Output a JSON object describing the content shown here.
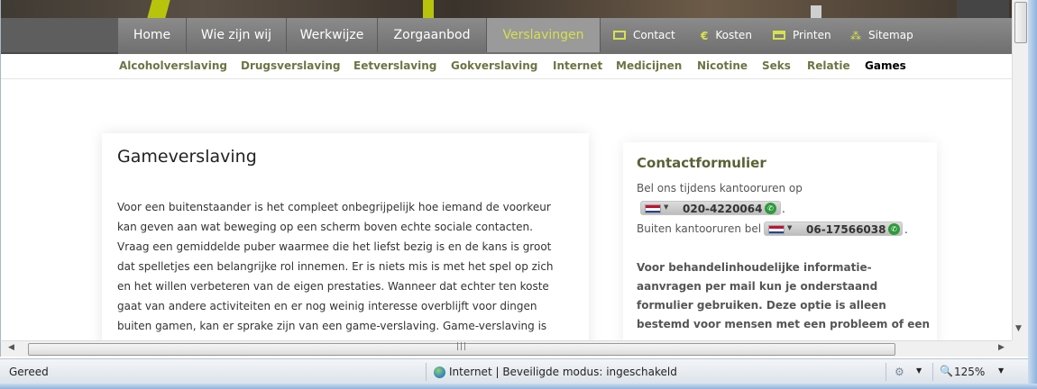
{
  "main_nav": {
    "tabs": [
      {
        "label": "Home"
      },
      {
        "label": "Wie zijn wij"
      },
      {
        "label": "Werkwijze"
      },
      {
        "label": "Zorgaanbod"
      },
      {
        "label": "Verslavingen"
      }
    ],
    "active_tab": "Verslavingen",
    "utility_links": [
      {
        "label": "Contact",
        "icon": "contact-icon"
      },
      {
        "label": "Kosten",
        "icon": "euro-icon"
      },
      {
        "label": "Printen",
        "icon": "print-icon"
      },
      {
        "label": "Sitemap",
        "icon": "sitemap-icon"
      }
    ]
  },
  "sub_nav": {
    "items": [
      "Alcoholverslaving",
      "Drugsverslaving",
      "Eetverslaving",
      "Gokverslaving",
      "Internet",
      "Medicijnen",
      "Nicotine",
      "Seks",
      "Relatie",
      "Games"
    ],
    "active_item": "Games"
  },
  "article": {
    "title": "Gameverslaving",
    "lines": [
      "Voor een buitenstaander is het compleet onbegrijpelijk hoe iemand de voorkeur",
      "kan geven aan wat beweging op een scherm boven echte sociale contacten.",
      "Vraag een gemiddelde puber waarmee die het liefst bezig is en de kans is groot",
      "dat spelletjes een belangrijke rol innemen. Er is niets mis is met het spel op zich",
      "en het willen verbeteren van de eigen prestaties. Wanneer dat echter ten koste",
      "gaat van andere activiteiten en er nog weinig interesse overblijft voor dingen",
      "buiten gamen, kan er sprake zijn van een game-verslaving. Game-verslaving is"
    ]
  },
  "contact": {
    "title": "Contactformulier",
    "office_hours_text": "Bel ons tijdens kantooruren op",
    "office_phone": "020-4220064",
    "after_hours_text": "Buiten kantooruren bel",
    "after_hours_phone": "06-17566038",
    "period": ".",
    "info_lines": [
      "Voor behandelinhoudelijke informatie-",
      "aanvragen per mail kun je onderstaand",
      "formulier gebruiken. Deze optie is alleen",
      "bestemd voor mensen met een probleem of een"
    ]
  },
  "status_bar": {
    "left_text": "Gereed",
    "zone_text": "Internet | Beveiligde modus: ingeschakeld",
    "zoom": "125%"
  },
  "colors": {
    "nav_bg": "#6f6f6f",
    "nav_active_text": "#d6e04a",
    "subnav_text": "#6e7444",
    "heading_olive": "#5b6136",
    "accent_green": "#b8c40c"
  }
}
